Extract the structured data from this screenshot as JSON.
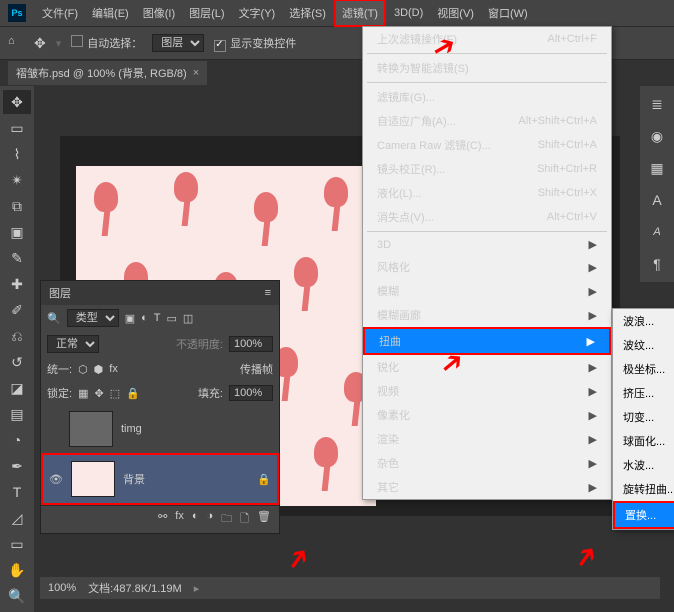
{
  "menubar": {
    "items": [
      "文件(F)",
      "编辑(E)",
      "图像(I)",
      "图层(L)",
      "文字(Y)",
      "选择(S)",
      "滤镜(T)",
      "3D(D)",
      "视图(V)",
      "窗口(W)"
    ],
    "active_index": 6
  },
  "optbar": {
    "auto_select_label": "自动选择：",
    "target": "图层",
    "show_transform_label": "显示变换控件"
  },
  "tab": {
    "title": "褶皱布.psd @ 100% (背景, RGB/8)",
    "close": "×"
  },
  "filter_menu": {
    "last_filter": "上次滤镜操作(F)",
    "last_shortcut": "Alt+Ctrl+F",
    "smart": "转换为智能滤镜(S)",
    "gallery": "滤镜库(G)...",
    "adaptive": "自适应广角(A)...",
    "adaptive_sc": "Alt+Shift+Ctrl+A",
    "camera": "Camera Raw 滤镜(C)...",
    "camera_sc": "Shift+Ctrl+A",
    "lens": "镜头校正(R)...",
    "lens_sc": "Shift+Ctrl+R",
    "liquify": "液化(L)...",
    "liquify_sc": "Shift+Ctrl+X",
    "vanish": "消失点(V)...",
    "vanish_sc": "Alt+Ctrl+V",
    "groups": [
      "3D",
      "风格化",
      "模糊",
      "模糊画廊",
      "扭曲",
      "锐化",
      "视频",
      "像素化",
      "渲染",
      "杂色",
      "其它"
    ],
    "hot_index": 4
  },
  "submenu": {
    "items": [
      "波浪...",
      "波纹...",
      "极坐标...",
      "挤压...",
      "切变...",
      "球面化...",
      "水波...",
      "旋转扭曲...",
      "置换..."
    ],
    "hot_index": 8
  },
  "layers": {
    "title": "图层",
    "kind_label": "类型",
    "blend": "正常",
    "opacity_label": "不透明度:",
    "opacity": "100%",
    "unify_label": "统一:",
    "propagate_label": "传播帧",
    "lock_label": "锁定:",
    "fill_label": "填充:",
    "fill": "100%",
    "items": [
      {
        "name": "timg",
        "visible": false,
        "locked": false
      },
      {
        "name": "背景",
        "visible": true,
        "locked": true
      }
    ]
  },
  "status": {
    "zoom": "100%",
    "doc_label": "文档:",
    "doc": "487.8K/1.19M"
  },
  "right_icons": [
    "layers",
    "color",
    "swatches",
    "char",
    "para",
    "styles"
  ]
}
